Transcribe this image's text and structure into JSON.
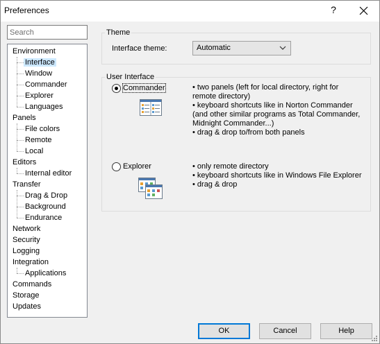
{
  "window": {
    "title": "Preferences",
    "help_glyph": "?"
  },
  "search": {
    "placeholder": "Search"
  },
  "tree": [
    {
      "label": "Environment",
      "level": 0
    },
    {
      "label": "Interface",
      "level": 1,
      "selected": true
    },
    {
      "label": "Window",
      "level": 1
    },
    {
      "label": "Commander",
      "level": 1
    },
    {
      "label": "Explorer",
      "level": 1
    },
    {
      "label": "Languages",
      "level": 1
    },
    {
      "label": "Panels",
      "level": 0
    },
    {
      "label": "File colors",
      "level": 1
    },
    {
      "label": "Remote",
      "level": 1
    },
    {
      "label": "Local",
      "level": 1
    },
    {
      "label": "Editors",
      "level": 0
    },
    {
      "label": "Internal editor",
      "level": 1
    },
    {
      "label": "Transfer",
      "level": 0
    },
    {
      "label": "Drag & Drop",
      "level": 1
    },
    {
      "label": "Background",
      "level": 1
    },
    {
      "label": "Endurance",
      "level": 1
    },
    {
      "label": "Network",
      "level": 0
    },
    {
      "label": "Security",
      "level": 0
    },
    {
      "label": "Logging",
      "level": 0
    },
    {
      "label": "Integration",
      "level": 0
    },
    {
      "label": "Applications",
      "level": 1
    },
    {
      "label": "Commands",
      "level": 0
    },
    {
      "label": "Storage",
      "level": 0
    },
    {
      "label": "Updates",
      "level": 0
    }
  ],
  "theme": {
    "group_title": "Theme",
    "label": "Interface theme:",
    "value": "Automatic"
  },
  "user_interface": {
    "group_title": "User Interface",
    "commander": {
      "label": "Commander",
      "checked": true,
      "bullets": [
        "•  two panels (left for local directory, right for",
        "remote directory)",
        "•  keyboard shortcuts like in Norton Commander",
        "(and other similar programs as Total Commander,",
        "Midnight Commander...)",
        "•  drag & drop to/from both panels"
      ]
    },
    "explorer": {
      "label": "Explorer",
      "checked": false,
      "bullets": [
        "•  only remote directory",
        "•  keyboard shortcuts like in Windows File Explorer",
        "•  drag & drop"
      ]
    }
  },
  "buttons": {
    "ok": "OK",
    "cancel": "Cancel",
    "help": "Help"
  },
  "colors": {
    "selection": "#cce8ff",
    "accent": "#0078d7"
  }
}
